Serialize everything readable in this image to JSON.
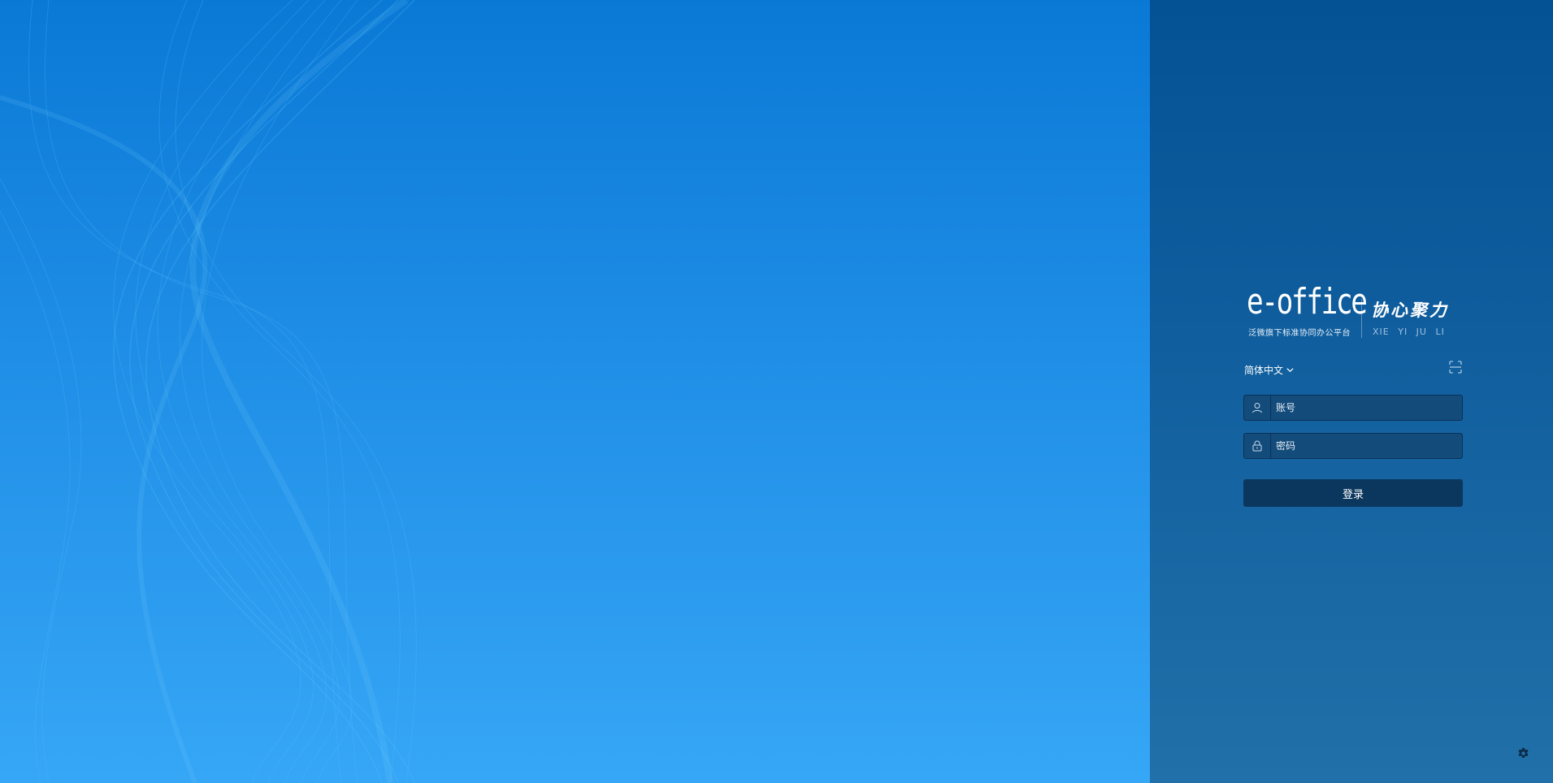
{
  "brand": {
    "logo_text": "e-office",
    "logo_subtitle": "泛微旗下标准协同办公平台",
    "slogan": "协心聚力",
    "slogan_pinyin": "XIE  YI  JU  LI"
  },
  "login": {
    "language": "简体中文",
    "username_placeholder": "账号",
    "password_placeholder": "密码",
    "submit_label": "登录"
  },
  "icons": {
    "language_dropdown": "chevron-down-icon",
    "qr_login": "qr-scan-icon",
    "username": "user-icon",
    "password": "lock-icon",
    "settings": "gear-icon"
  },
  "colors": {
    "panel_top": "#045294",
    "panel_bottom": "#2170a9",
    "background_top": "#0a79d6",
    "background_bottom": "#36a6f6",
    "input_bg": "#134b7b",
    "button_bg": "#0b375e"
  }
}
